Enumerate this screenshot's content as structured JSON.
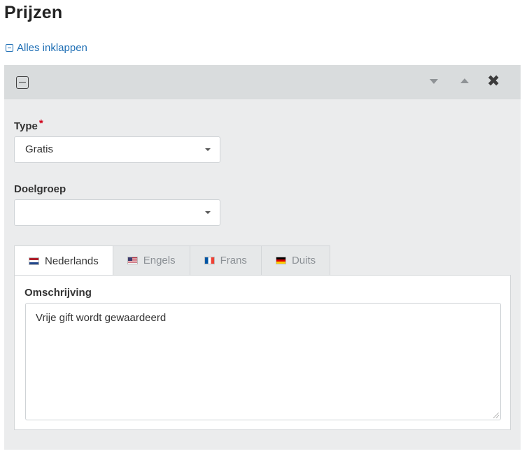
{
  "page": {
    "title": "Prijzen"
  },
  "collapse_all": {
    "label": "Alles inklappen",
    "icon": "collapse-square-icon"
  },
  "panel": {
    "header_icons": [
      "collapse-square-icon",
      "move-down-icon",
      "move-up-icon",
      "close-icon"
    ],
    "remove_glyph": "✖",
    "type_field": {
      "label": "Type",
      "required_marker": "*",
      "value": "Gratis"
    },
    "audience_field": {
      "label": "Doelgroep",
      "value": ""
    },
    "tabs": [
      {
        "label": "Nederlands",
        "flag": "nl-flag-icon",
        "active": true
      },
      {
        "label": "Engels",
        "flag": "us-flag-icon",
        "active": false
      },
      {
        "label": "Frans",
        "flag": "fr-flag-icon",
        "active": false
      },
      {
        "label": "Duits",
        "flag": "de-flag-icon",
        "active": false
      }
    ],
    "description": {
      "label": "Omschrijving",
      "value": "Vrije gift wordt gewaardeerd"
    }
  },
  "colors": {
    "link": "#1f6fb5",
    "required": "#d0021b",
    "panel_bg": "#ebeced",
    "panel_header_bg": "#d9dcdd"
  }
}
